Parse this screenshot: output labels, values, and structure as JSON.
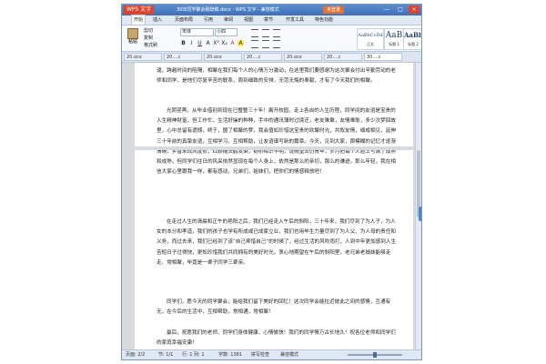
{
  "window": {
    "app_button": "WPS 文字",
    "title": "30年同学聚会致辞稿.docx - WPS 文字 - 兼容模式",
    "login_button": "未登录",
    "controls": [
      "—",
      "□",
      "×"
    ]
  },
  "menu": [
    "开始",
    "插入",
    "页面布局",
    "引用",
    "审阅",
    "视图",
    "章节",
    "开发工具",
    "特色功能"
  ],
  "ribbon": {
    "paste": "粘贴",
    "clip_items": [
      "剪切",
      "复制",
      "格式刷"
    ],
    "font_name": "宋体",
    "font_size": "小四",
    "format_buttons": [
      "B",
      "I",
      "U",
      "A",
      "X²",
      "X₂",
      "A",
      "A"
    ],
    "styles": [
      {
        "sample": "AaBbCcDd",
        "name": "正文"
      },
      {
        "sample": "AaB",
        "name": "标题 1"
      },
      {
        "sample": "AaBb",
        "name": "标题 2"
      }
    ]
  },
  "tabs": [
    "20.ocx",
    "20....c",
    "20.ocx",
    "20....c",
    "20.ocx",
    "20....c",
    "30....c"
  ],
  "document": {
    "paragraphs": [
      "谴、跨越时间的阻隔，相聚在我们每个人的心情万分激动，在这里我们要感谢为这次聚会付出辛勤劳动的老师和同学，是他们尽复辛苦的联系，周到细致的安排，无范无悔的奉献，才有了今天我们的相聚。",
      "光阴荏苒，从毕业借别到现在已整整三十年！离开校园，走上各自的人生历程，同学间的友谊是宝贵的人生精神财富，但工作忙，生活好操的种种，手中的通讯薄时过境迁，老友难聚，友情难耿，多少次梦回故里，心中总留有遗憾，终于，圆了相聚的梦，我会值如珍惜这宝贵的欢聚时光，共叙友情，细成相见，延伸三十年前的真挚友谊，互相学习，互相帮助，让友谊谱写新的篇章。今天，见到大家，那模糊的记忆才逐渐清晰，乡音未改风度依，红颜褪去鹤发染，韧桥相识不明，淀晴重去仍青年，岁月把每个人脸上写满了成熟和成熟，但同学们往日的风采依然显现在每个人身上，依然是那么的亲切，那么的谦逊，那么年轻，我在相信大家心里跟我一样，都有感动，兄弟们，姐妹们，把你们的情感释放吧！",
      "在走过人生的清晨和正午的艳阳之后，我们已经走入午后的斜阳，三十年来，我们尽到了为人子，为人女的本分和孝道，我们的孩子也学有所成或已成家立业，我们也用毕生力量尽到了为人父、为人母的责任和义务，而过去来，我们已经到了该“自己疼惜自己”的时候了，经过生活的风吹雨打，人到中年更加感到人生苦短日子过得快，更知珍惜我们共同拥有的美好时光，衷心地期望在午后的斜阳里，老兄弟老姊妹能够走走、常相聚，毕竟是一辈子同学三辈亲。",
      "同学们，愿今天的同学聚会，能给我们留下美好的回忆！这次同学会能拉近彼此之间的感情，互通有无，在今后的生活中，互相帮助，常相通，常相聚！",
      "最后，祝愿我们的老师、同学们身体健康、心情愉快！我们的同学情万古长地久！祝各位老师和同学们的家庭幸福安康！"
    ]
  },
  "status": {
    "page": "页面: 2/2",
    "section": "节: 1/1",
    "row": "行: 1 列: 1",
    "words": "字数: 1381",
    "spell": "拼写检查",
    "mode": "兼容模式"
  },
  "colors": {
    "accent": "#3c6fb6",
    "app_button": "#d8462f",
    "login": "#e8722c"
  }
}
